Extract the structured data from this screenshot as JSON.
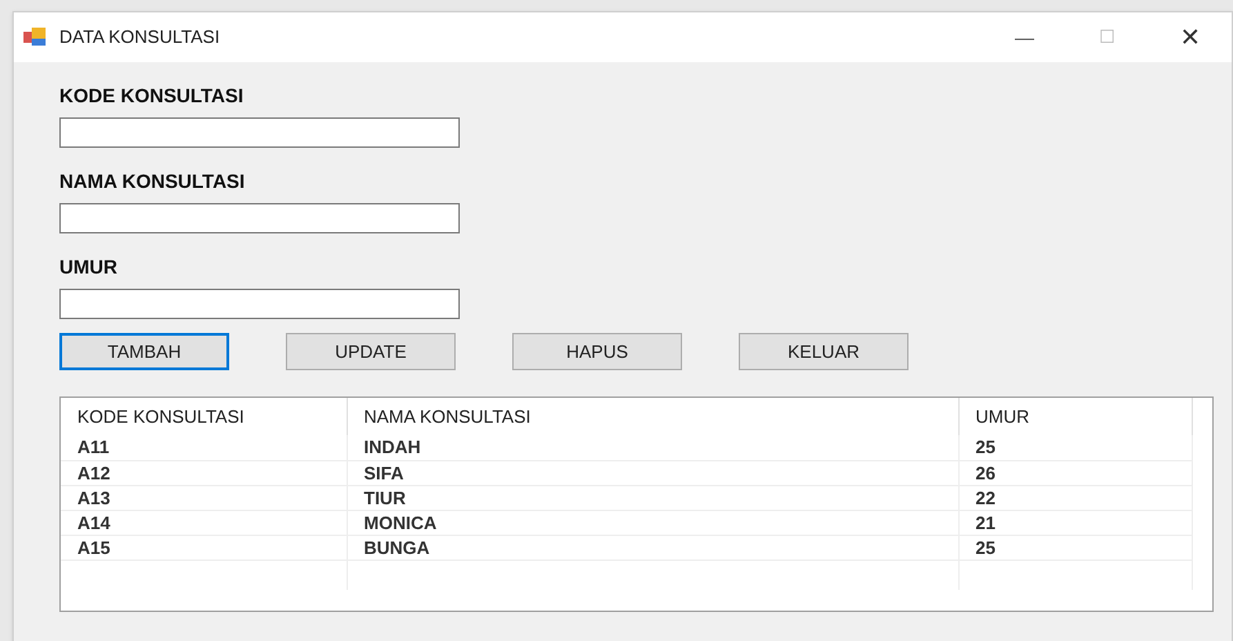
{
  "window": {
    "title": "DATA KONSULTASI",
    "controls": [
      "—",
      "☐",
      "✕"
    ]
  },
  "fields": [
    {
      "label": "KODE KONSULTASI"
    },
    {
      "label": "NAMA KONSULTASI"
    },
    {
      "label": "UMUR"
    }
  ],
  "buttons": [
    {
      "label": "TAMBAH",
      "focused": true
    },
    {
      "label": "UPDATE",
      "focused": false
    },
    {
      "label": "HAPUS",
      "focused": false
    },
    {
      "label": "KELUAR",
      "focused": false
    }
  ],
  "table": {
    "columns": [
      "KODE KONSULTASI",
      "NAMA KONSULTASI",
      "UMUR"
    ],
    "rows": [
      [
        "A11",
        "INDAH",
        "25"
      ],
      [
        "A12",
        "SIFA",
        "26"
      ],
      [
        "A13",
        "TIUR",
        "22"
      ],
      [
        "A14",
        "MONICA",
        "21"
      ],
      [
        "A15",
        "BUNGA",
        "25"
      ]
    ]
  }
}
